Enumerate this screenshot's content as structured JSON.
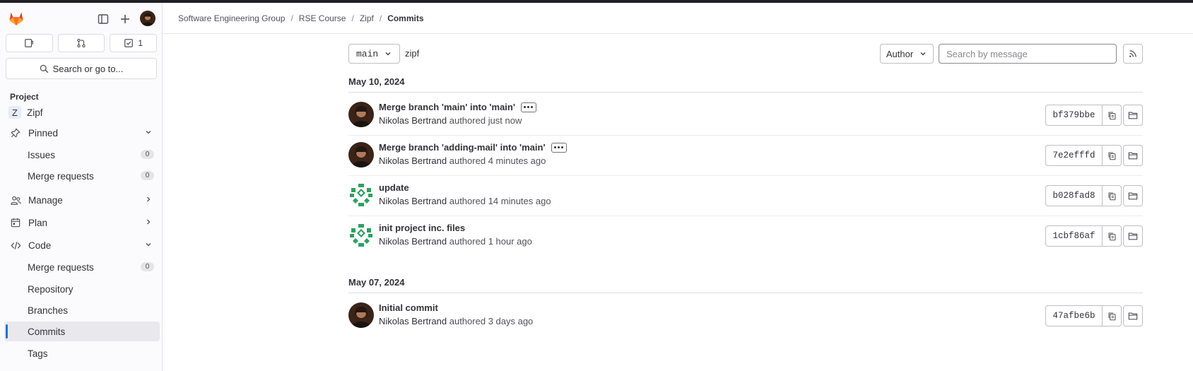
{
  "sidebar": {
    "counters": [
      {
        "icon": "issues-icon",
        "count": ""
      },
      {
        "icon": "merge-request-icon",
        "count": ""
      },
      {
        "icon": "todo-icon",
        "count": "1"
      }
    ],
    "search_label": "Search or go to...",
    "section_title": "Project",
    "project_initial": "Z",
    "project_name": "Zipf",
    "items": {
      "pinned": "Pinned",
      "issues": "Issues",
      "issues_count": "0",
      "merge_requests": "Merge requests",
      "merge_requests_count": "0",
      "manage": "Manage",
      "plan": "Plan",
      "code": "Code",
      "code_merge_requests": "Merge requests",
      "code_merge_requests_count": "0",
      "repository": "Repository",
      "branches": "Branches",
      "commits": "Commits",
      "tags": "Tags"
    }
  },
  "breadcrumb": [
    "Software Engineering Group",
    "RSE Course",
    "Zipf",
    "Commits"
  ],
  "toolbar": {
    "branch": "main",
    "path": "zipf",
    "author_label": "Author",
    "search_placeholder": "Search by message"
  },
  "days": [
    {
      "date": "May 10, 2024",
      "commits": [
        {
          "title": "Merge branch 'main' into 'main'",
          "has_ellipsis": true,
          "author": "Nikolas Bertrand",
          "action": "authored",
          "time": "just now",
          "sha": "bf379bbe",
          "avatar": "photo"
        },
        {
          "title": "Merge branch 'adding-mail' into 'main'",
          "has_ellipsis": true,
          "author": "Nikolas Bertrand",
          "action": "authored",
          "time": "4 minutes ago",
          "sha": "7e2efffd",
          "avatar": "photo"
        },
        {
          "title": "update",
          "has_ellipsis": false,
          "author": "Nikolas Bertrand",
          "action": "authored",
          "time": "14 minutes ago",
          "sha": "b028fad8",
          "avatar": "identicon"
        },
        {
          "title": "init project inc. files",
          "has_ellipsis": false,
          "author": "Nikolas Bertrand",
          "action": "authored",
          "time": "1 hour ago",
          "sha": "1cbf86af",
          "avatar": "identicon"
        }
      ]
    },
    {
      "date": "May 07, 2024",
      "commits": [
        {
          "title": "Initial commit",
          "has_ellipsis": false,
          "author": "Nikolas Bertrand",
          "action": "authored",
          "time": "3 days ago",
          "sha": "47afbe6b",
          "avatar": "photo"
        }
      ]
    }
  ],
  "colors": {
    "accent": "#1f75cb",
    "identicon": "#2da160",
    "logo": "#e24329"
  }
}
